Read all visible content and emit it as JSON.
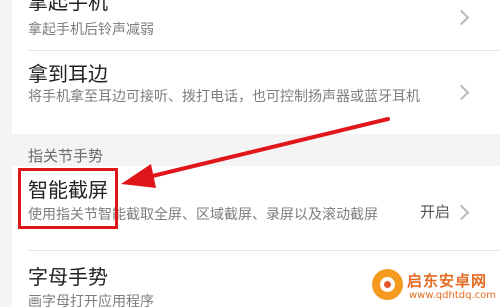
{
  "settings": {
    "row_pickup": {
      "title": "拿起手机",
      "subtitle": "拿起手机后铃声减弱"
    },
    "row_ear": {
      "title": "拿到耳边",
      "subtitle": "将手机拿至耳边可接听、拨打电话，也可控制扬声器或蓝牙耳机"
    },
    "section_knuckle": {
      "header": "指关节手势"
    },
    "row_smart_screenshot": {
      "title": "智能截屏",
      "subtitle": "使用指关节智能截取全屏、区域截屏、录屏以及滚动截屏",
      "value": "开启"
    },
    "row_letter": {
      "title": "字母手势",
      "subtitle": "画字母打开应用程序"
    }
  },
  "annotation": {
    "color": "#e0161b"
  },
  "watermark": {
    "site_name": "启东安卓网",
    "url": "www.qdhtdq.com"
  }
}
